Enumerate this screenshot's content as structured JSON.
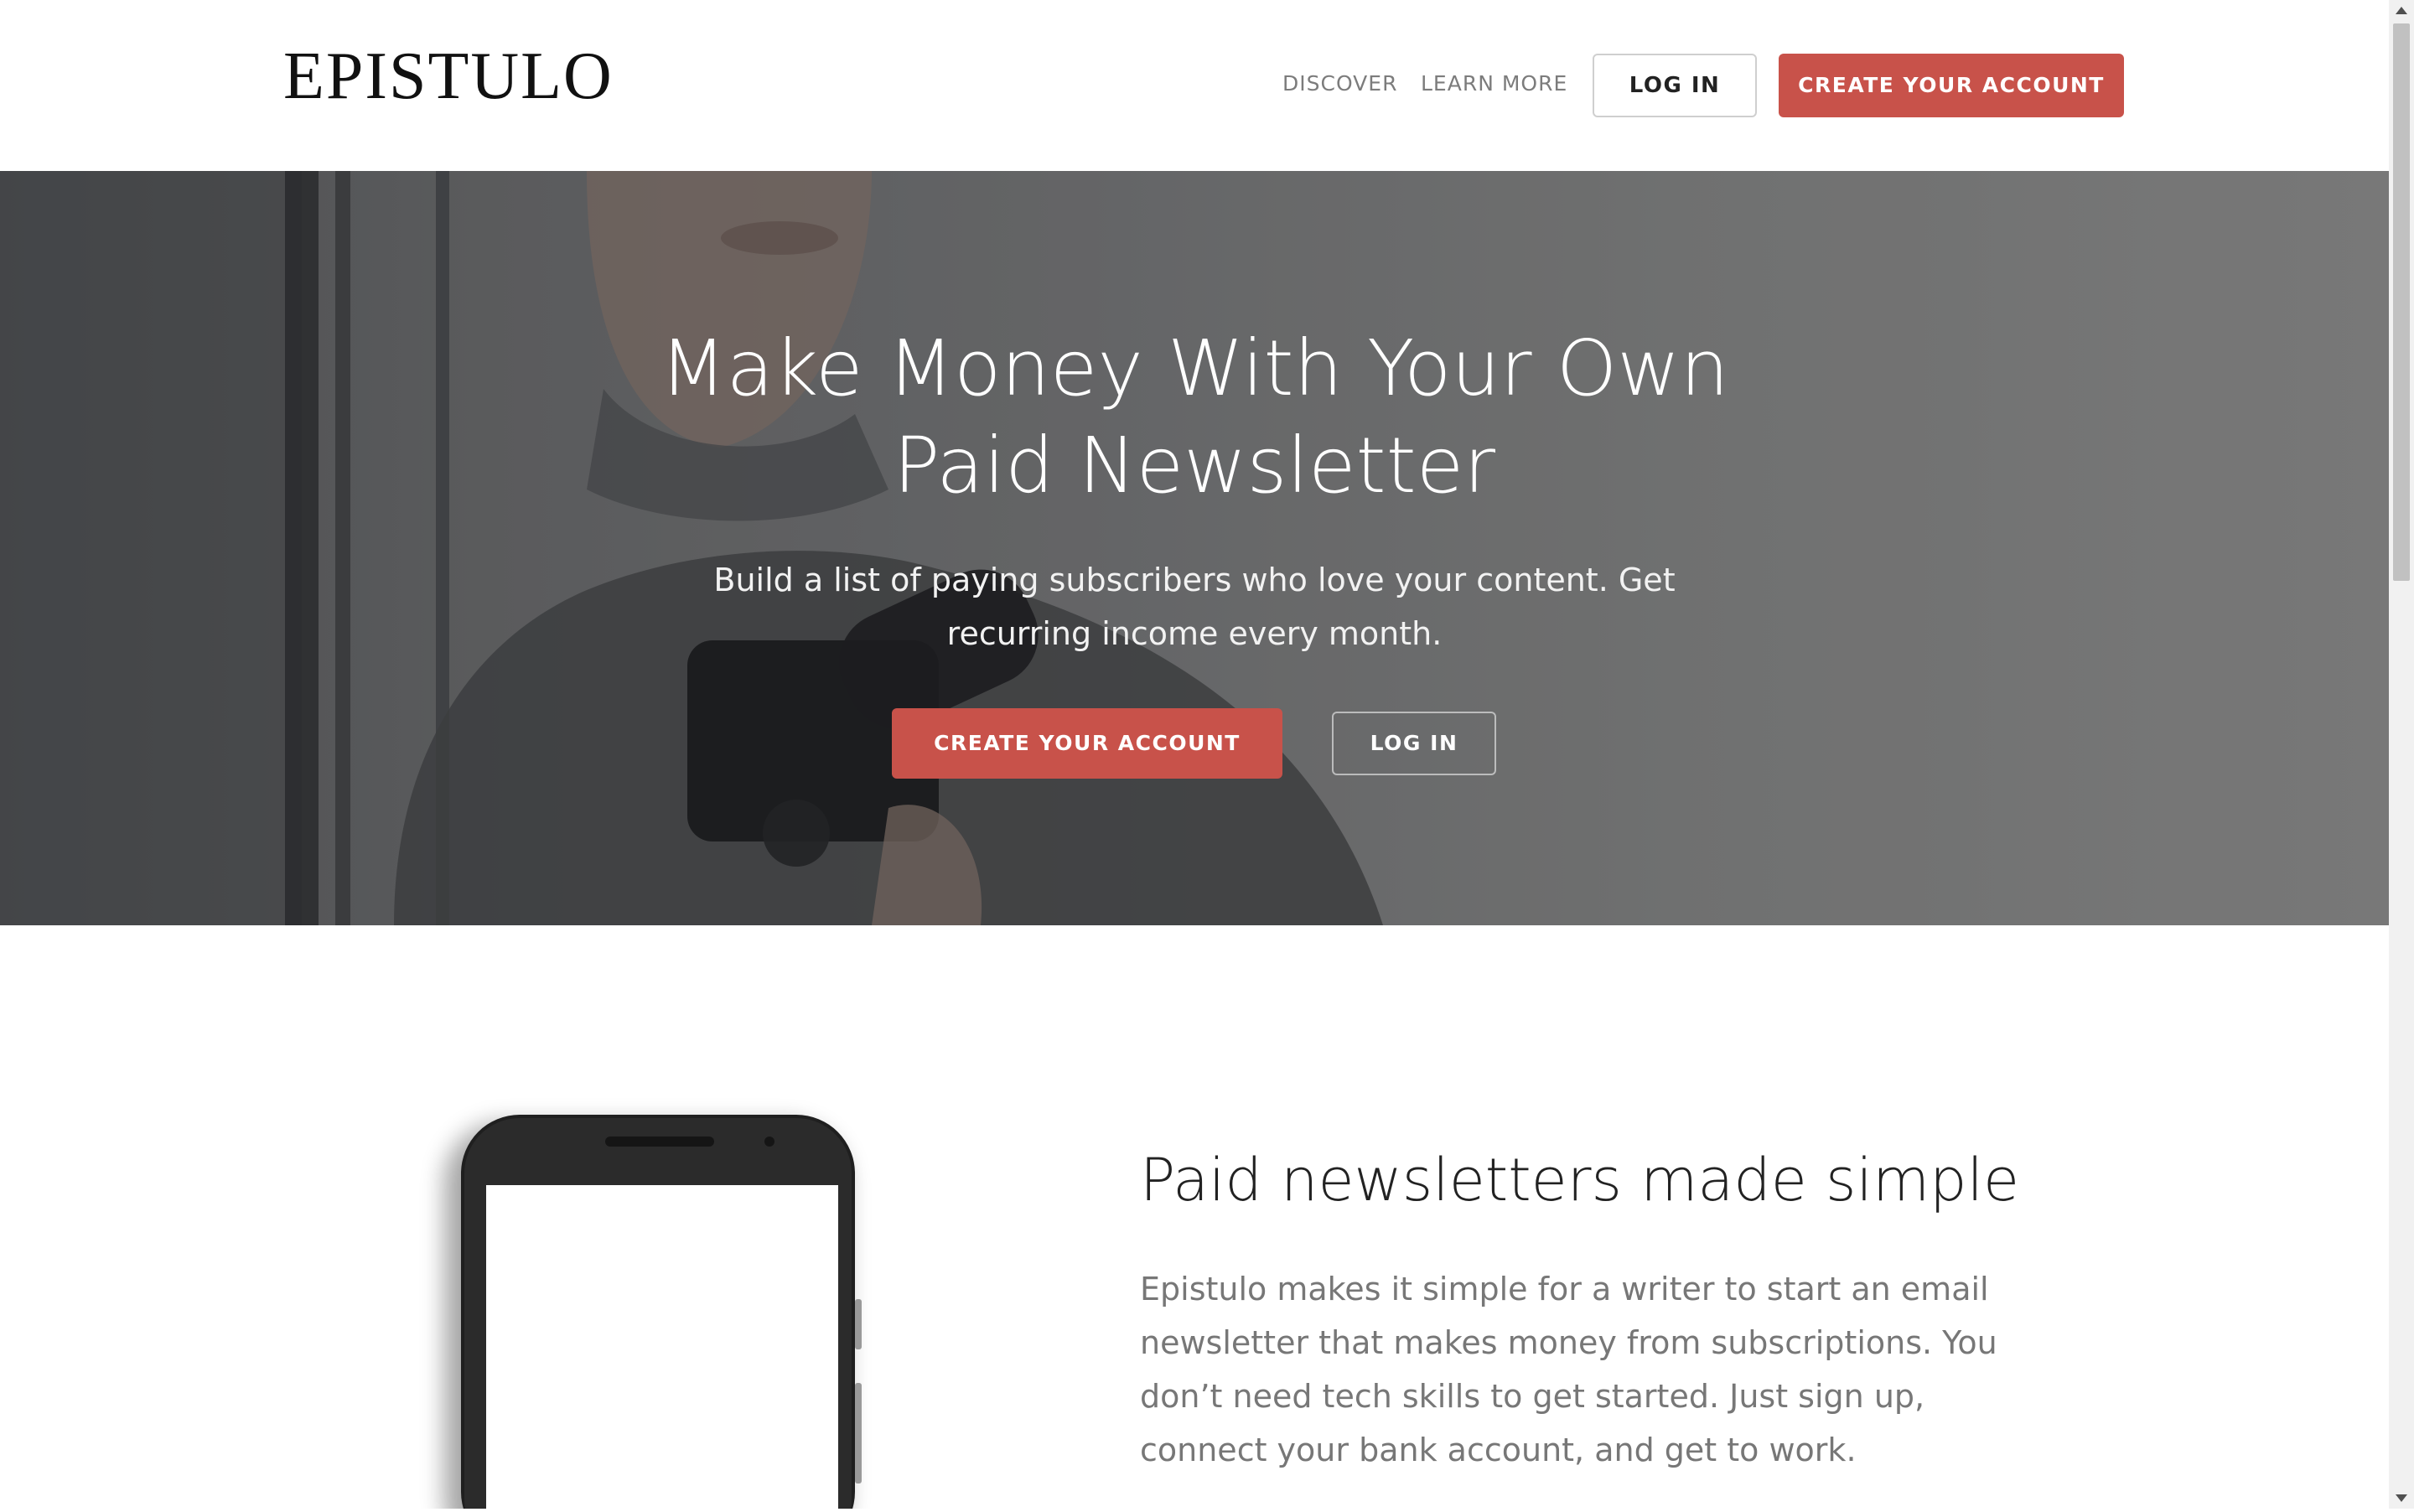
{
  "header": {
    "logo": "EPISTULO",
    "nav": {
      "discover": "DISCOVER",
      "learn_more": "LEARN MORE",
      "log_in": "LOG IN",
      "create_account": "CREATE YOUR ACCOUNT"
    }
  },
  "hero": {
    "title_line1": "Make Money With Your Own",
    "title_line2": "Paid Newsletter",
    "subtitle": "Build a list of paying subscribers who love your content. Get recurring income every month.",
    "cta_primary": "CREATE YOUR ACCOUNT",
    "cta_secondary": "LOG IN"
  },
  "feature": {
    "title": "Paid newsletters made simple",
    "body": "Epistulo makes it simple for a writer to start an email newsletter that makes money from subscriptions. You don’t need tech skills to get started. Just sign up, connect your bank account, and get to work."
  },
  "colors": {
    "accent_red": "#c8524a",
    "text_dark": "#222222",
    "text_muted": "#777777"
  }
}
